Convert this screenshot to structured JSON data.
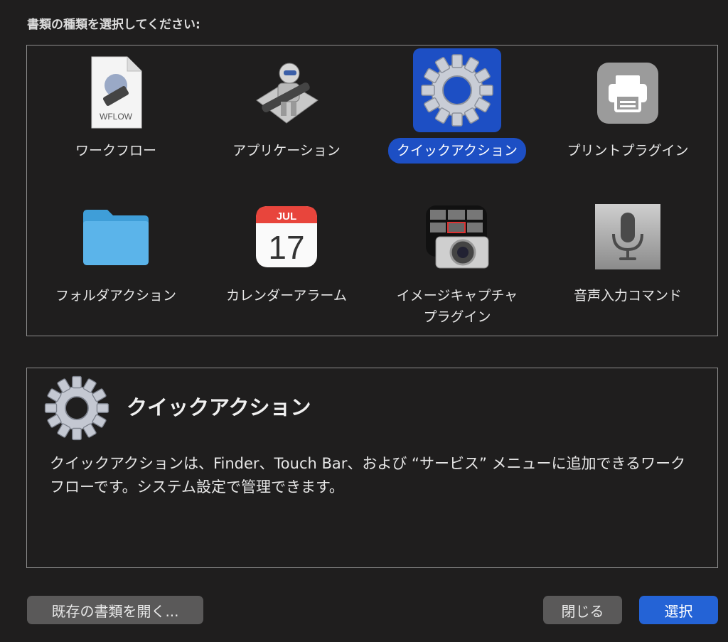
{
  "prompt": "書類の種類を選択してください:",
  "items": [
    {
      "label": "ワークフロー",
      "icon": "workflow-document-icon",
      "wflow": "WFLOW"
    },
    {
      "label": "アプリケーション",
      "icon": "automator-robot-icon"
    },
    {
      "label": "クイックアクション",
      "icon": "gear-icon",
      "selected": true
    },
    {
      "label": "プリントプラグイン",
      "icon": "printer-icon"
    },
    {
      "label": "フォルダアクション",
      "icon": "folder-icon"
    },
    {
      "label": "カレンダーアラーム",
      "icon": "calendar-icon",
      "cal_month": "JUL",
      "cal_day": "17"
    },
    {
      "label_line1": "イメージキャプチャ",
      "label_line2": "プラグイン",
      "icon": "image-capture-icon"
    },
    {
      "label": "音声入力コマンド",
      "icon": "microphone-icon"
    }
  ],
  "detail": {
    "title": "クイックアクション",
    "description": "クイックアクションは、Finder、Touch Bar、および “サービス” メニューに追加できるワークフローです。システム設定で管理できます。"
  },
  "buttons": {
    "open_existing": "既存の書類を開く...",
    "close": "閉じる",
    "choose": "選択"
  },
  "colors": {
    "accent": "#2463d6",
    "selection": "#1d4fc4",
    "background": "#1f1e1e"
  }
}
